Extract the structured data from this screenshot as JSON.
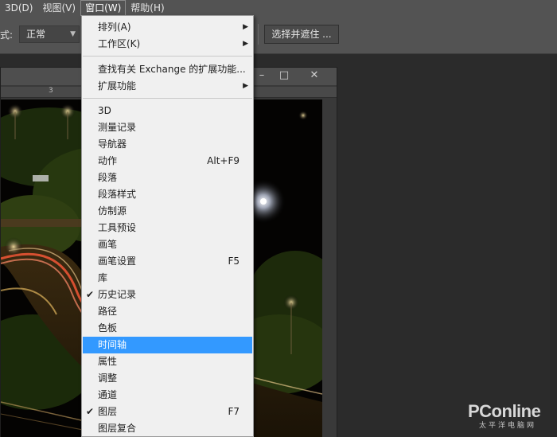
{
  "menubar": {
    "items": [
      {
        "label": "3D(D)"
      },
      {
        "label": "视图(V)"
      },
      {
        "label": "窗口(W)"
      },
      {
        "label": "帮助(H)"
      }
    ]
  },
  "options": {
    "style_label": "式:",
    "style_value": "正常",
    "select_and_mask": "选择并遮住 ..."
  },
  "document": {
    "ruler_number": "3",
    "minimize": "–",
    "restore": "□",
    "close": "✕"
  },
  "window_menu": {
    "items": [
      {
        "label": "排列(A)",
        "submenu": true
      },
      {
        "label": "工作区(K)",
        "submenu": true
      },
      {
        "label": "查找有关 Exchange 的扩展功能..."
      },
      {
        "label": "扩展功能",
        "submenu": true
      },
      {
        "label": "3D"
      },
      {
        "label": "测量记录"
      },
      {
        "label": "导航器"
      },
      {
        "label": "动作",
        "shortcut": "Alt+F9"
      },
      {
        "label": "段落"
      },
      {
        "label": "段落样式"
      },
      {
        "label": "仿制源"
      },
      {
        "label": "工具预设"
      },
      {
        "label": "画笔"
      },
      {
        "label": "画笔设置",
        "shortcut": "F5"
      },
      {
        "label": "库"
      },
      {
        "label": "历史记录",
        "checked": true
      },
      {
        "label": "路径"
      },
      {
        "label": "色板"
      },
      {
        "label": "时间轴",
        "highlighted": true
      },
      {
        "label": "属性"
      },
      {
        "label": "调整"
      },
      {
        "label": "通道"
      },
      {
        "label": "图层",
        "shortcut": "F7",
        "checked": true
      },
      {
        "label": "图层复合"
      }
    ],
    "check_glyph": "✔",
    "arrow_glyph": "▶"
  },
  "watermark": {
    "brand": "PConline",
    "sub": "太平洋电脑网"
  },
  "colors": {
    "highlight": "#3399ff",
    "menu_bg": "#f0f0f0",
    "app_bg": "#2b2b2b",
    "bar_bg": "#535353"
  }
}
